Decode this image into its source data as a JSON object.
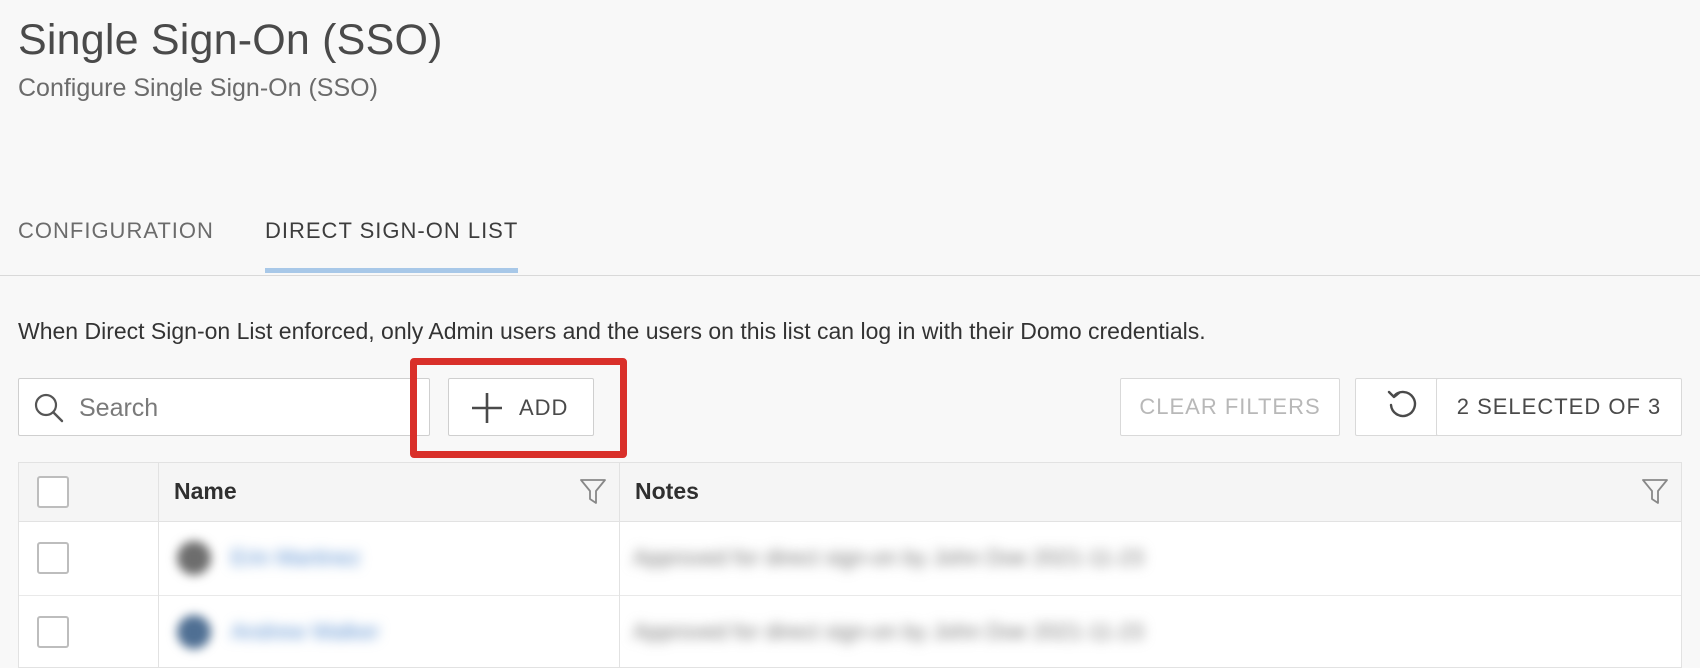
{
  "header": {
    "title": "Single Sign-On (SSO)",
    "subtitle": "Configure Single Sign-On (SSO)"
  },
  "tabs": [
    {
      "label": "CONFIGURATION",
      "active": false
    },
    {
      "label": "DIRECT SIGN-ON LIST",
      "active": true
    }
  ],
  "description": "When Direct Sign-on List enforced, only Admin users and the users on this list can log in with their Domo credentials.",
  "toolbar": {
    "search_placeholder": "Search",
    "search_value": "",
    "add_label": "ADD",
    "clear_filters_label": "CLEAR FILTERS",
    "selection_label": "2 SELECTED OF 3"
  },
  "grid": {
    "columns": [
      "Name",
      "Notes"
    ],
    "rows": [
      {
        "name": "Erin Martinez",
        "notes": "Approved for direct sign-on by John Doe 2021-11-23"
      },
      {
        "name": "Andrew Walker",
        "notes": "Approved for direct sign-on by John Doe 2021-11-23"
      }
    ]
  },
  "colors": {
    "highlight": "#d9302a",
    "tab_underline": "#a8c8e8",
    "link": "#5a8fd0"
  },
  "icons": [
    "search-icon",
    "plus-icon",
    "reset-icon",
    "filter-icon"
  ]
}
